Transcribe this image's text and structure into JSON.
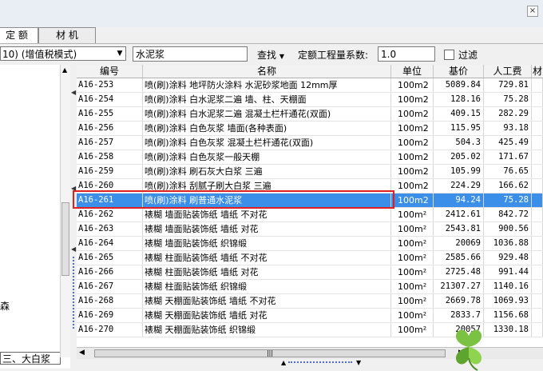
{
  "tabs": [
    {
      "label": "定 额",
      "active": true
    },
    {
      "label": "材 机",
      "active": false
    }
  ],
  "toolbar": {
    "combo_value": "10) (增值税模式)",
    "search_value": "水泥浆",
    "find_label": "查找",
    "coef_label": "定额工程量系数:",
    "coef_value": "1.0",
    "filter_label": "过滤"
  },
  "left_panel": {
    "node1": "森",
    "node2": "三、大白浆"
  },
  "columns": [
    "编号",
    "名称",
    "单位",
    "基价",
    "人工费",
    "材"
  ],
  "rows": [
    {
      "code": "A16-253",
      "name": "喷(刷)涂料 地坪防火涂料 水泥砂浆地面 12mm厚",
      "unit": "100m2",
      "price": "5089.84",
      "labor": "729.81"
    },
    {
      "code": "A16-254",
      "name": "喷(刷)涂料 白水泥浆二遍 墙、柱、天棚面",
      "unit": "100m2",
      "price": "128.16",
      "labor": "75.28"
    },
    {
      "code": "A16-255",
      "name": "喷(刷)涂料 白水泥浆二遍 混凝土栏杆通花(双面)",
      "unit": "100m2",
      "price": "409.15",
      "labor": "282.29"
    },
    {
      "code": "A16-256",
      "name": "喷(刷)涂料 白色灰浆 墙面(各种表面)",
      "unit": "100m2",
      "price": "115.95",
      "labor": "93.18"
    },
    {
      "code": "A16-257",
      "name": "喷(刷)涂料 白色灰浆 混凝土栏杆通花(双面)",
      "unit": "100m2",
      "price": "504.3",
      "labor": "425.49"
    },
    {
      "code": "A16-258",
      "name": "喷(刷)涂料 白色灰浆一般天棚",
      "unit": "100m2",
      "price": "205.02",
      "labor": "171.67"
    },
    {
      "code": "A16-259",
      "name": "喷(刷)涂料 刷石灰大白浆 三遍",
      "unit": "100m2",
      "price": "105.99",
      "labor": "76.65"
    },
    {
      "code": "A16-260",
      "name": "喷(刷)涂料 刮腻子刷大白浆 三遍",
      "unit": "100m2",
      "price": "224.29",
      "labor": "166.62"
    },
    {
      "code": "A16-261",
      "name": "喷(刷)涂料 刷普通水泥浆",
      "unit": "100m2",
      "price": "94.24",
      "labor": "75.28",
      "selected": true
    },
    {
      "code": "A16-262",
      "name": "裱糊 墙面贴装饰纸 墙纸 不对花",
      "unit": "100m²",
      "price": "2412.61",
      "labor": "842.72"
    },
    {
      "code": "A16-263",
      "name": "裱糊 墙面贴装饰纸 墙纸 对花",
      "unit": "100m²",
      "price": "2543.81",
      "labor": "900.56"
    },
    {
      "code": "A16-264",
      "name": "裱糊 墙面贴装饰纸 织锦缎",
      "unit": "100m²",
      "price": "20069",
      "labor": "1036.88"
    },
    {
      "code": "A16-265",
      "name": "裱糊 柱面贴装饰纸 墙纸 不对花",
      "unit": "100m²",
      "price": "2585.66",
      "labor": "929.48"
    },
    {
      "code": "A16-266",
      "name": "裱糊 柱面贴装饰纸 墙纸 对花",
      "unit": "100m²",
      "price": "2725.48",
      "labor": "991.44"
    },
    {
      "code": "A16-267",
      "name": "裱糊 柱面贴装饰纸 织锦缎",
      "unit": "100m²",
      "price": "21307.27",
      "labor": "1140.16"
    },
    {
      "code": "A16-268",
      "name": "裱糊 天棚面贴装饰纸 墙纸 不对花",
      "unit": "100m²",
      "price": "2669.78",
      "labor": "1069.93"
    },
    {
      "code": "A16-269",
      "name": "裱糊 天棚面贴装饰纸 墙纸 对花",
      "unit": "100m²",
      "price": "2833.7",
      "labor": "1156.68"
    },
    {
      "code": "A16-270",
      "name": "裱糊 天棚面贴装饰纸 织锦缎",
      "unit": "100m²",
      "price": "20057",
      "labor": "1330.18"
    }
  ]
}
